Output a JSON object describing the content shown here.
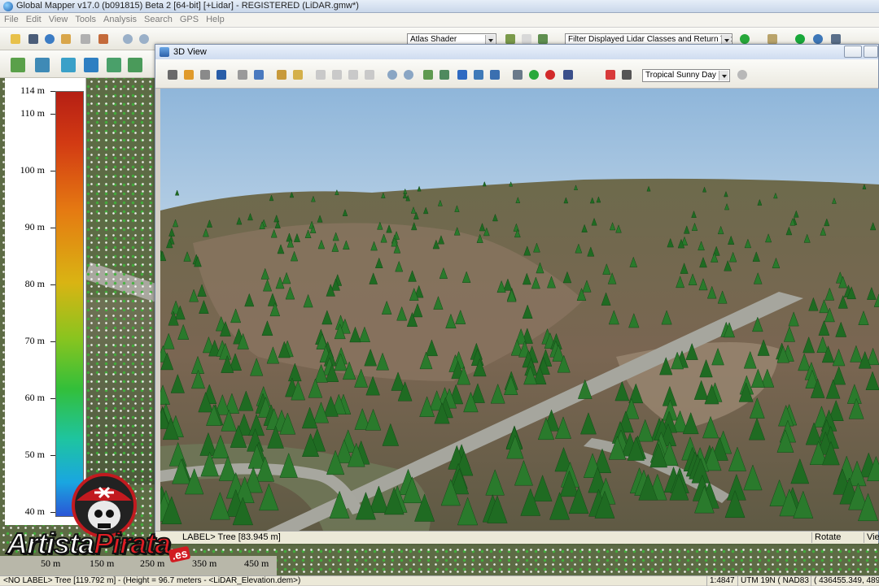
{
  "app": {
    "title": "Global Mapper v17.0 (b091815) Beta 2 [64-bit] [+Lidar] - REGISTERED (LiDAR.gmw*)"
  },
  "menu": [
    "File",
    "Edit",
    "View",
    "Tools",
    "Analysis",
    "Search",
    "GPS",
    "Help"
  ],
  "toolbar": {
    "shader": "Atlas Shader",
    "lidar_filter": "Filter Displayed Lidar Classes and Return Types"
  },
  "legend": {
    "ticks": [
      "114 m",
      "110 m",
      "100 m",
      "90 m",
      "80 m",
      "70 m",
      "60 m",
      "50 m",
      "40 m"
    ]
  },
  "scale": {
    "labels": [
      "50 m",
      "150 m",
      "250 m",
      "350 m",
      "450 m"
    ]
  },
  "view3d": {
    "title": "3D View",
    "sky": "Tropical Sunny Day",
    "status_label": "LABEL> Tree [83.945 m]",
    "mode": "Rotate",
    "view": "View"
  },
  "status": {
    "left": "<NO LABEL> Tree [119.792 m] - (Height = 96.7 meters - <LiDAR_Elevation.dem>)",
    "scale": "1:4847",
    "proj": "UTM 19N ( NAD83 )",
    "coords": "( 436455.349, 489437"
  },
  "watermark": {
    "part1": "Artista",
    "part2": "Pirata",
    "suffix": ".es"
  },
  "colors": {
    "tree": "#1f6b22",
    "road": "#a6a69e",
    "ground": "#8a7560",
    "sky": "#bcd2e6"
  }
}
